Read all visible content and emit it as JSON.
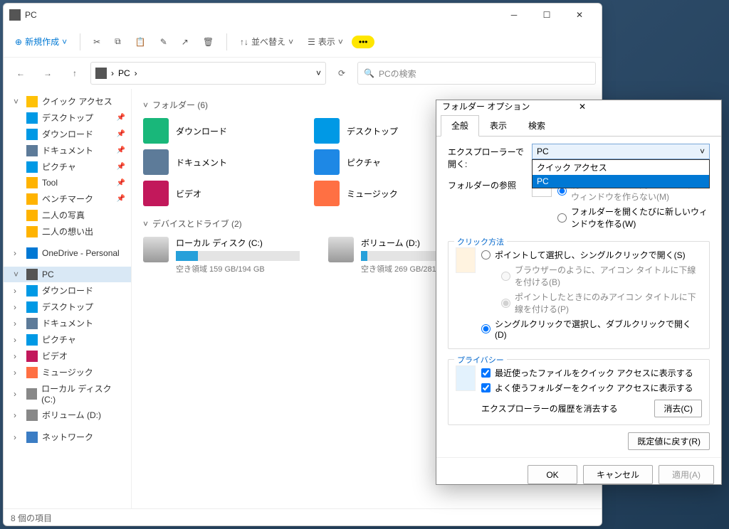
{
  "window": {
    "title": "PC"
  },
  "toolbar": {
    "new": "新規作成",
    "sort": "並べ替え",
    "view": "表示"
  },
  "breadcrumb": {
    "root": "PC"
  },
  "search": {
    "placeholder": "PCの検索"
  },
  "sidebar": {
    "quickaccess": "クイック アクセス",
    "desktop": "デスクトップ",
    "downloads": "ダウンロード",
    "documents": "ドキュメント",
    "pictures": "ピクチャ",
    "tool": "Tool",
    "benchmark": "ベンチマーク",
    "photos2": "二人の写真",
    "memories2": "二人の想い出",
    "onedrive": "OneDrive - Personal",
    "pc": "PC",
    "pc_downloads": "ダウンロード",
    "pc_desktop": "デスクトップ",
    "pc_documents": "ドキュメント",
    "pc_pictures": "ピクチャ",
    "pc_videos": "ビデオ",
    "pc_music": "ミュージック",
    "pc_driveC": "ローカル ディスク (C:)",
    "pc_driveD": "ボリューム (D:)",
    "network": "ネットワーク"
  },
  "content": {
    "folders_header": "フォルダー (6)",
    "folders": {
      "downloads": "ダウンロード",
      "desktop": "デスクトップ",
      "documents": "ドキュメント",
      "pictures": "ピクチャ",
      "videos": "ビデオ",
      "music": "ミュージック"
    },
    "drives_header": "デバイスとドライブ (2)",
    "driveC": {
      "name": "ローカル ディスク (C:)",
      "free": "空き領域 159 GB/194 GB",
      "pct": 18
    },
    "driveD": {
      "name": "ボリューム (D:)",
      "free": "空き領域 269 GB/281 GB",
      "pct": 5
    }
  },
  "status": {
    "text": "8 個の項目"
  },
  "dialog": {
    "title": "フォルダー オプション",
    "tabs": {
      "general": "全般",
      "view": "表示",
      "search": "検索"
    },
    "open_label": "エクスプローラーで開く:",
    "combo_value": "PC",
    "combo_opt1": "クイック アクセス",
    "combo_opt2": "PC",
    "browse_label": "フォルダーの参照",
    "browse_opt1": "別のフォルダーを開くときに新しいウィンドウを作らない(M)",
    "browse_opt2": "フォルダーを開くたびに新しいウィンドウを作る(W)",
    "click_label": "クリック方法",
    "click_opt1": "ポイントして選択し、シングルクリックで開く(S)",
    "click_sub1": "ブラウザーのように、アイコン タイトルに下線を付ける(B)",
    "click_sub2": "ポイントしたときにのみアイコン タイトルに下線を付ける(P)",
    "click_opt2": "シングルクリックで選択し、ダブルクリックで開く(D)",
    "privacy_label": "プライバシー",
    "privacy_chk1": "最近使ったファイルをクイック アクセスに表示する",
    "privacy_chk2": "よく使うフォルダーをクイック アクセスに表示する",
    "history_label": "エクスプローラーの履歴を消去する",
    "clear_btn": "消去(C)",
    "restore_btn": "既定値に戻す(R)",
    "ok": "OK",
    "cancel": "キャンセル",
    "apply": "適用(A)"
  }
}
